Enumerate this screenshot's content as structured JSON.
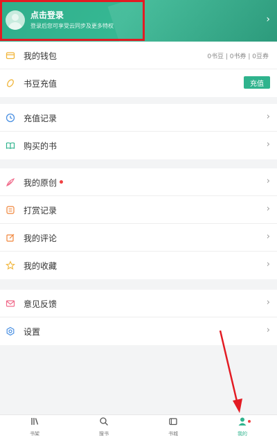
{
  "header": {
    "login_title": "点击登录",
    "login_subtitle": "登录后您可享受云同步及更多特权",
    "chevron": "›"
  },
  "menu": {
    "group1": [
      {
        "icon": "wallet-icon",
        "label": "我的钱包",
        "right_text": "0书豆 | 0书券 | 0豆券",
        "icon_color": "#f0b53a"
      },
      {
        "icon": "bean-icon",
        "label": "书豆充值",
        "button": "充值",
        "icon_color": "#f0b53a"
      }
    ],
    "group2": [
      {
        "icon": "clock-icon",
        "label": "充值记录",
        "icon_color": "#4a90e2"
      },
      {
        "icon": "book-icon",
        "label": "购买的书",
        "icon_color": "#2fb38d"
      }
    ],
    "group3": [
      {
        "icon": "feather-icon",
        "label": "我的原创",
        "has_dot": true,
        "icon_color": "#f06a8a"
      },
      {
        "icon": "list-icon",
        "label": "打赏记录",
        "icon_color": "#f0853a"
      },
      {
        "icon": "edit-icon",
        "label": "我的评论",
        "icon_color": "#f0853a"
      },
      {
        "icon": "star-icon",
        "label": "我的收藏",
        "icon_color": "#f0b53a"
      }
    ],
    "group4": [
      {
        "icon": "mail-icon",
        "label": "意见反馈",
        "icon_color": "#f06a8a"
      },
      {
        "icon": "gear-icon",
        "label": "设置",
        "icon_color": "#4a90e2"
      }
    ]
  },
  "tabbar": [
    {
      "icon": "bookshelf-icon",
      "label": "书架",
      "active": false
    },
    {
      "icon": "search-icon",
      "label": "搜书",
      "active": false
    },
    {
      "icon": "bookstore-icon",
      "label": "书城",
      "active": false
    },
    {
      "icon": "profile-icon",
      "label": "我的",
      "active": true
    }
  ],
  "colors": {
    "accent": "#2fb38d",
    "highlight_border": "#e31b23",
    "notification_dot": "#f04142"
  }
}
